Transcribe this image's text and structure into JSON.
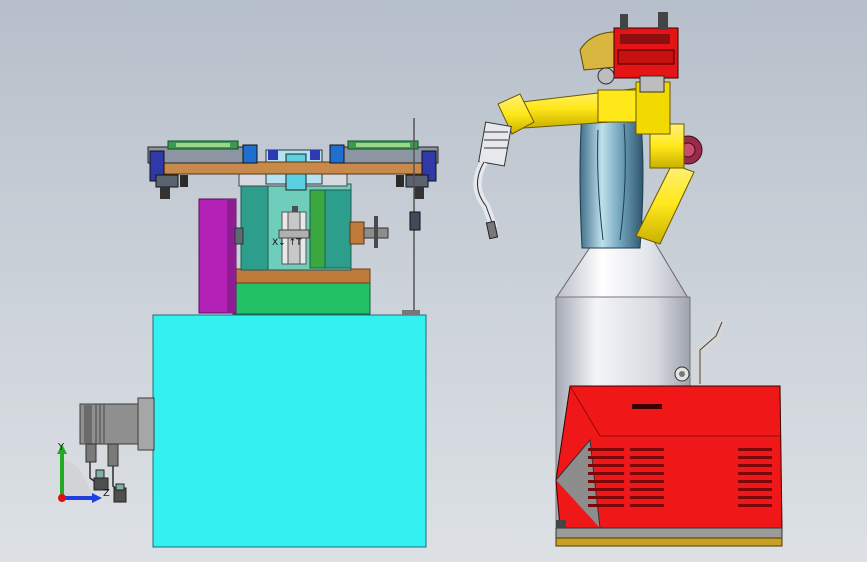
{
  "orientation_triad": {
    "y_label": "Y",
    "z_label": "Z",
    "colors": {
      "y": "#22aa22",
      "z": "#1f3fe0",
      "origin": "#e01010"
    }
  },
  "labels": {
    "slide_marking": "X↓ ↑T"
  },
  "colors": {
    "base_cabinet": "#33f1f1",
    "robot_arm": "#ffe81a",
    "controller_red": "#ef1717",
    "green_plate": "#22c165",
    "bronze_plate": "#c07a3a",
    "purple_motor": "#b321b7",
    "teal_housing": "#2e9e8c",
    "silver": "#e6e8ee"
  }
}
